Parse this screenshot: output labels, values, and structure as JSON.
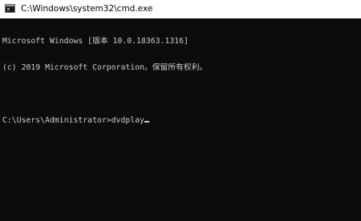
{
  "window": {
    "title": "C:\\Windows\\system32\\cmd.exe",
    "icon": "cmd-icon"
  },
  "console": {
    "lines": [
      "Microsoft Windows [版本 10.0.18363.1316]",
      "(c) 2019 Microsoft Corporation。保留所有权利。",
      "",
      "C:\\Users\\Administrator>dvdplay"
    ]
  },
  "colors": {
    "background": "#0c0c0c",
    "text": "#cccccc",
    "titlebar": "#ffffff"
  }
}
